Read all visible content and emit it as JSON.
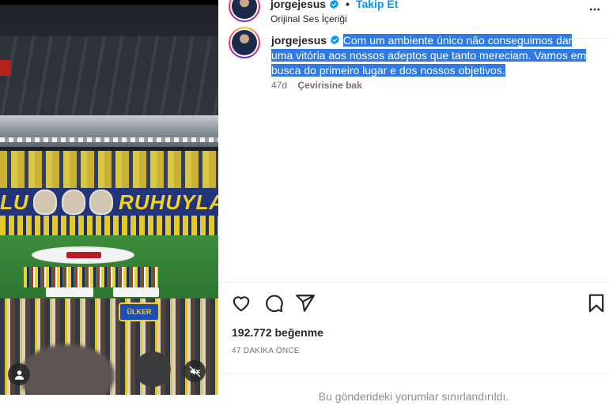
{
  "media": {
    "banner_left": "LU",
    "banner_right": "RUHUYLA",
    "sponsor": "ÜLKER",
    "user_tag_icon": "user-tag-icon",
    "mute_icon": "speaker-muted-icon"
  },
  "header": {
    "username": "jorgejesus",
    "follow_label": "Takip Et",
    "audio_label": "Orijinal Ses İçeriği",
    "more_icon": "more-horizontal-icon"
  },
  "caption": {
    "username": "jorgejesus",
    "text": "Com um ambiente único não conseguimos dar uma vitória aos nossos adeptos que tanto mereciam. Vamos em busca do primeiro lugar e dos nossos objetivos.",
    "age": "47d",
    "translate_label": "Çevirisine bak"
  },
  "actions": {
    "like_icon": "heart-icon",
    "comment_icon": "comment-icon",
    "share_icon": "send-icon",
    "save_icon": "bookmark-icon"
  },
  "likes": "192.772 beğenme",
  "timestamp": "47 DAKİKA ÖNCE",
  "comments_restricted": "Bu gönderideki yorumlar sınırlandırıldı.",
  "colors": {
    "accent": "#0095f6",
    "selection": "#2f7be5",
    "muted_text": "#737373"
  }
}
